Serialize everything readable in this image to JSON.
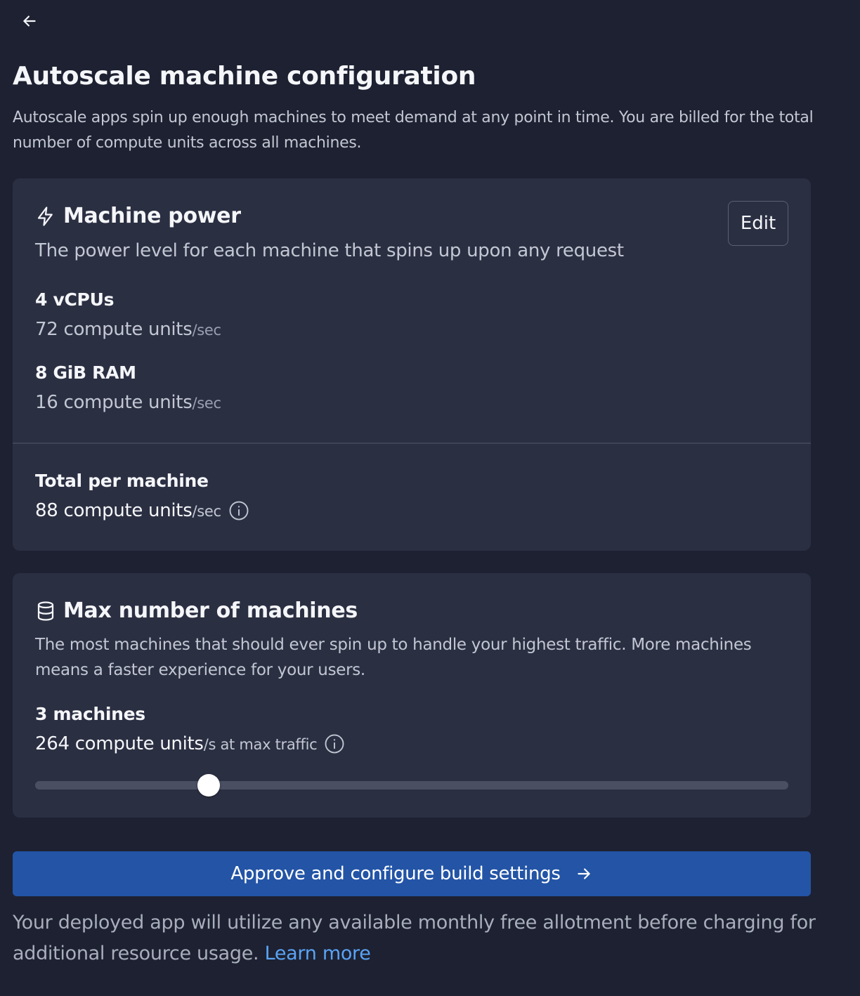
{
  "page": {
    "title": "Autoscale machine configuration",
    "intro": "Autoscale apps spin up enough machines to meet demand at any point in time. You are billed for the total number of compute units across all machines."
  },
  "machine_power": {
    "title": "Machine power",
    "description": "The power level for each machine that spins up upon any request",
    "edit_label": "Edit",
    "vcpu_label": "4 vCPUs",
    "vcpu_units": "72 compute units",
    "ram_label": "8 GiB RAM",
    "ram_units": "16 compute units",
    "per_sec": "/sec",
    "total_label": "Total per machine",
    "total_units": "88 compute units"
  },
  "max_machines": {
    "title": "Max number of machines",
    "description": "The most machines that should ever spin up to handle your highest traffic. More machines means a faster experience for your users.",
    "count_label": "3 machines",
    "units": "264 compute units",
    "units_suffix": "/s at max traffic",
    "slider_fraction": 0.23
  },
  "actions": {
    "approve_label": "Approve and configure build settings"
  },
  "footer": {
    "text": "Your deployed app will utilize any available monthly free allotment before charging for additional resource usage.",
    "link_label": "Learn more"
  },
  "icons": {
    "back": "arrow-left-icon",
    "power": "lightning-icon",
    "machines": "database-icon",
    "info": "info-icon",
    "approve": "arrow-right-icon"
  },
  "colors": {
    "background": "#1d2131",
    "card": "#2b2f42",
    "primary": "#2354a6",
    "link": "#5aa3f5"
  }
}
